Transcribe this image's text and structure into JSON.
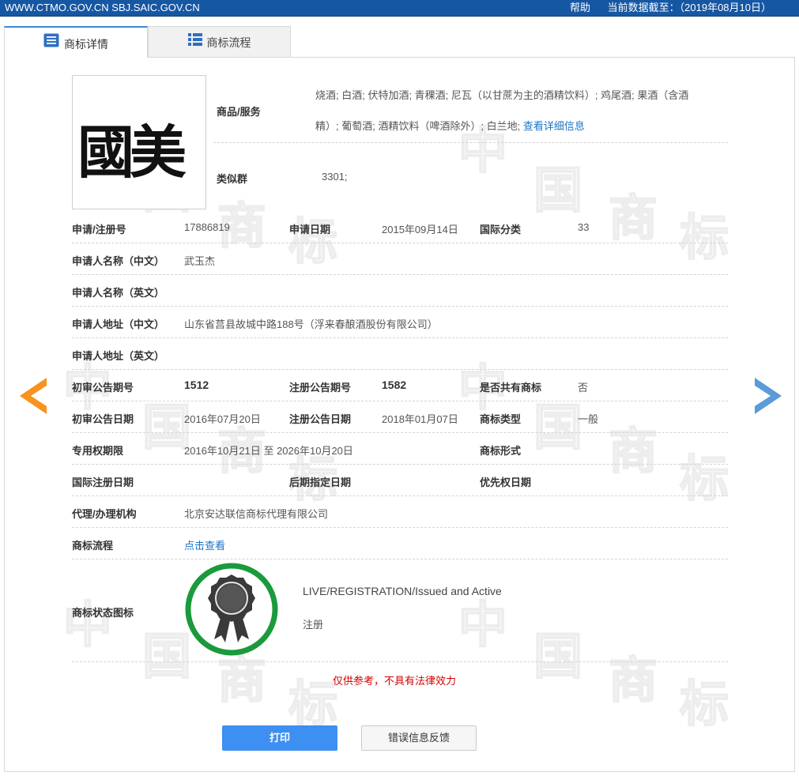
{
  "topbar": {
    "site": "WWW.CTMO.GOV.CN SBJ.SAIC.GOV.CN",
    "help": "帮助",
    "data_as_of": "当前数据截至：（2019年08月10日）"
  },
  "tabs": [
    {
      "label": "商标详情"
    },
    {
      "label": "商标流程"
    }
  ],
  "watermark": [
    "中",
    "国",
    "商",
    "标"
  ],
  "logo": {
    "text": "國美"
  },
  "goods": {
    "label": "商品/服务",
    "line1": "烧酒; 白酒; 伏特加酒; 青稞酒; 尼瓦（以甘蔗为主的酒精饮料）; 鸡尾酒; 果酒（含酒",
    "line2": "精）; 葡萄酒; 酒精饮料（啤酒除外）; 白兰地;",
    "more_link": "查看详细信息"
  },
  "similar_group": {
    "label": "类似群",
    "value": "3301;"
  },
  "fields": {
    "app_no_label": "申请/注册号",
    "app_no": "17886819",
    "app_date_label": "申请日期",
    "app_date": "2015年09月14日",
    "intl_class_label": "国际分类",
    "intl_class": "33",
    "applicant_cn_label": "申请人名称（中文）",
    "applicant_cn": "武玉杰",
    "applicant_en_label": "申请人名称（英文）",
    "address_cn_label": "申请人地址（中文）",
    "address_cn": "山东省莒县故城中路188号（浮来春酿酒股份有限公司）",
    "address_en_label": "申请人地址（英文）",
    "prelim_issue_label": "初审公告期号",
    "prelim_issue": "1512",
    "reg_issue_label": "注册公告期号",
    "reg_issue": "1582",
    "shared_label": "是否共有商标",
    "shared": "否",
    "prelim_date_label": "初审公告日期",
    "prelim_date": "2016年07月20日",
    "reg_date_label": "注册公告日期",
    "reg_date": "2018年01月07日",
    "type_label": "商标类型",
    "type": "一般",
    "term_label": "专用权期限",
    "term": "2016年10月21日 至 2026年10月20日",
    "form_label": "商标形式",
    "intl_reg_date_label": "国际注册日期",
    "later_designation_label": "后期指定日期",
    "priority_date_label": "优先权日期",
    "agent_label": "代理/办理机构",
    "agent": "北京安达联信商标代理有限公司",
    "process_label": "商标流程",
    "process_link": "点击查看"
  },
  "status": {
    "label": "商标状态图标",
    "en": "LIVE/REGISTRATION/Issued and Active",
    "cn": "注册",
    "ring_color": "#1a9a3c"
  },
  "disclaimer": "仅供参考，不具有法律效力",
  "buttons": {
    "print": "打印",
    "feedback": "错误信息反馈"
  },
  "colors": {
    "topbar": "#1657a3",
    "link": "#1a74c4",
    "disclaimer": "#d40000",
    "print_button": "#3d8ff1",
    "arrow_left": "#f7931e",
    "arrow_right": "#5b9bd8"
  }
}
